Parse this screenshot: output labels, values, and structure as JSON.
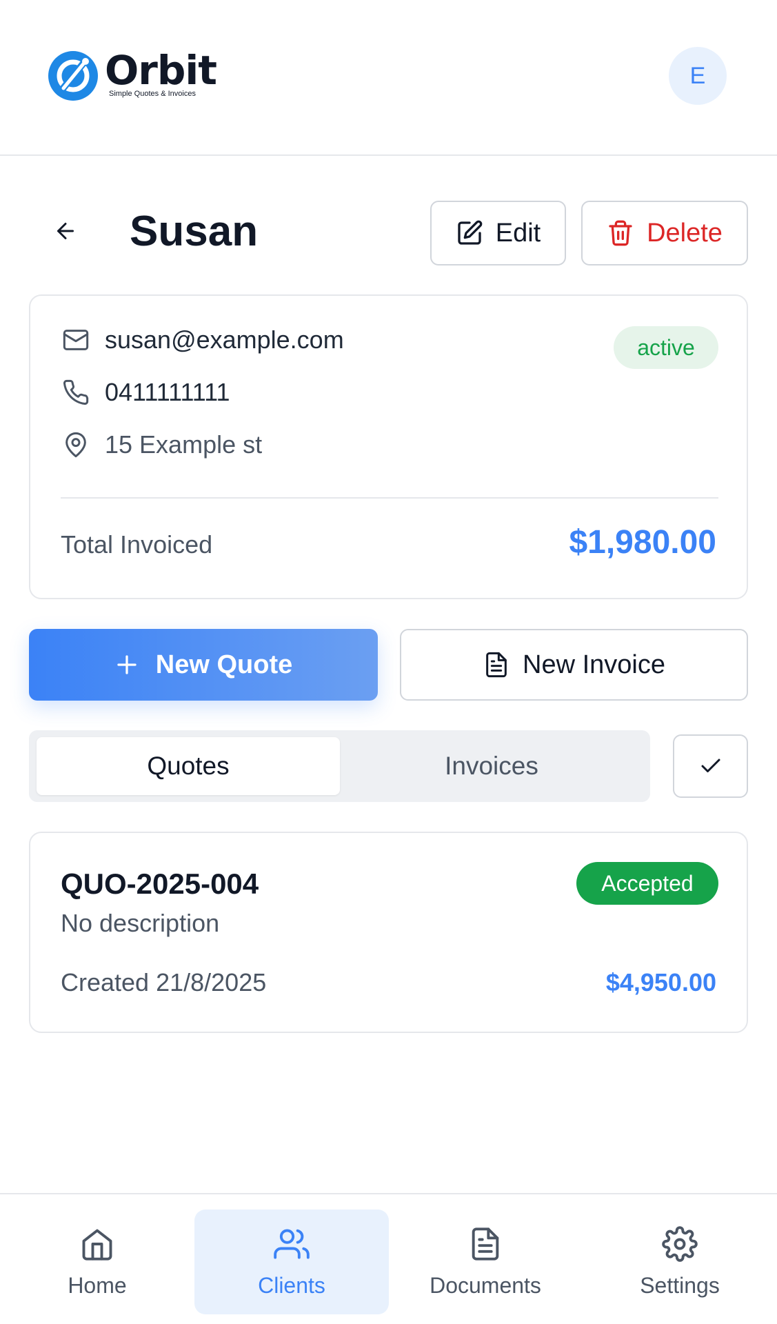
{
  "header": {
    "logo_name": "Orbit",
    "logo_tagline": "Simple Quotes & Invoices",
    "avatar_initial": "E"
  },
  "client": {
    "name": "Susan",
    "email": "susan@example.com",
    "phone": "0411111111",
    "address": "15 Example st",
    "status": "active",
    "total_label": "Total Invoiced",
    "total_value": "$1,980.00"
  },
  "actions": {
    "edit_label": "Edit",
    "delete_label": "Delete",
    "new_quote_label": "New Quote",
    "new_invoice_label": "New Invoice"
  },
  "tabs": [
    {
      "label": "Quotes",
      "active": true
    },
    {
      "label": "Invoices",
      "active": false
    }
  ],
  "quotes": [
    {
      "id": "QUO-2025-004",
      "description": "No description",
      "created": "Created 21/8/2025",
      "amount": "$4,950.00",
      "status": "Accepted"
    }
  ],
  "nav": [
    {
      "label": "Home",
      "icon": "home-icon",
      "active": false
    },
    {
      "label": "Clients",
      "icon": "users-icon",
      "active": true
    },
    {
      "label": "Documents",
      "icon": "document-icon",
      "active": false
    },
    {
      "label": "Settings",
      "icon": "gear-icon",
      "active": false
    }
  ],
  "colors": {
    "accent": "#3b82f6",
    "danger": "#dc2626",
    "success": "#16a34a",
    "success_bg": "#e6f4ea"
  }
}
